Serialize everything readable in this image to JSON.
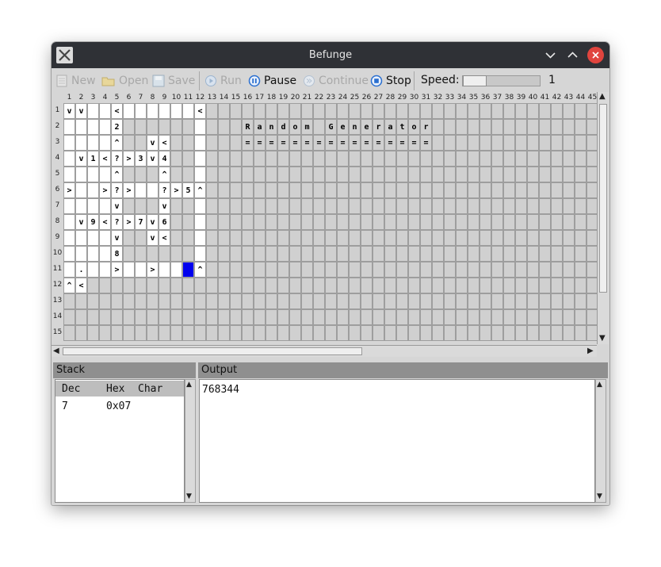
{
  "window": {
    "title": "Befunge"
  },
  "toolbar": {
    "new": "New",
    "open": "Open",
    "save": "Save",
    "run": "Run",
    "pause": "Pause",
    "continue": "Continue",
    "stop": "Stop",
    "speed_label": "Speed:",
    "speed_value": "1"
  },
  "grid": {
    "columns": [
      "1",
      "2",
      "3",
      "4",
      "5",
      "6",
      "7",
      "8",
      "9",
      "10",
      "11",
      "12",
      "13",
      "14",
      "15",
      "16",
      "17",
      "18",
      "19",
      "20",
      "21",
      "22",
      "23",
      "24",
      "25",
      "26",
      "27",
      "28",
      "29",
      "30",
      "31",
      "32",
      "33",
      "34",
      "35",
      "36",
      "37",
      "38",
      "39",
      "40",
      "41",
      "42",
      "43",
      "44",
      "45"
    ],
    "rows": [
      "1",
      "2",
      "3",
      "4",
      "5",
      "6",
      "7",
      "8",
      "9",
      "10",
      "11",
      "12",
      "13",
      "14",
      "15"
    ],
    "white_cells": [
      [
        1,
        1
      ],
      [
        2,
        1
      ],
      [
        3,
        1
      ],
      [
        4,
        1
      ],
      [
        5,
        1
      ],
      [
        6,
        1
      ],
      [
        7,
        1
      ],
      [
        8,
        1
      ],
      [
        9,
        1
      ],
      [
        10,
        1
      ],
      [
        11,
        1
      ],
      [
        12,
        1
      ],
      [
        1,
        2
      ],
      [
        2,
        2
      ],
      [
        3,
        2
      ],
      [
        4,
        2
      ],
      [
        5,
        2
      ],
      [
        12,
        2
      ],
      [
        1,
        3
      ],
      [
        2,
        3
      ],
      [
        3,
        3
      ],
      [
        4,
        3
      ],
      [
        5,
        3
      ],
      [
        8,
        3
      ],
      [
        9,
        3
      ],
      [
        12,
        3
      ],
      [
        1,
        4
      ],
      [
        2,
        4
      ],
      [
        3,
        4
      ],
      [
        4,
        4
      ],
      [
        5,
        4
      ],
      [
        6,
        4
      ],
      [
        7,
        4
      ],
      [
        8,
        4
      ],
      [
        9,
        4
      ],
      [
        12,
        4
      ],
      [
        1,
        5
      ],
      [
        2,
        5
      ],
      [
        3,
        5
      ],
      [
        4,
        5
      ],
      [
        5,
        5
      ],
      [
        9,
        5
      ],
      [
        12,
        5
      ],
      [
        1,
        6
      ],
      [
        2,
        6
      ],
      [
        3,
        6
      ],
      [
        4,
        6
      ],
      [
        5,
        6
      ],
      [
        6,
        6
      ],
      [
        7,
        6
      ],
      [
        8,
        6
      ],
      [
        9,
        6
      ],
      [
        10,
        6
      ],
      [
        11,
        6
      ],
      [
        12,
        6
      ],
      [
        1,
        7
      ],
      [
        2,
        7
      ],
      [
        3,
        7
      ],
      [
        4,
        7
      ],
      [
        5,
        7
      ],
      [
        9,
        7
      ],
      [
        12,
        7
      ],
      [
        1,
        8
      ],
      [
        2,
        8
      ],
      [
        3,
        8
      ],
      [
        4,
        8
      ],
      [
        5,
        8
      ],
      [
        6,
        8
      ],
      [
        7,
        8
      ],
      [
        8,
        8
      ],
      [
        9,
        8
      ],
      [
        12,
        8
      ],
      [
        1,
        9
      ],
      [
        2,
        9
      ],
      [
        3,
        9
      ],
      [
        4,
        9
      ],
      [
        5,
        9
      ],
      [
        8,
        9
      ],
      [
        9,
        9
      ],
      [
        12,
        9
      ],
      [
        1,
        10
      ],
      [
        2,
        10
      ],
      [
        3,
        10
      ],
      [
        4,
        10
      ],
      [
        5,
        10
      ],
      [
        12,
        10
      ],
      [
        1,
        11
      ],
      [
        2,
        11
      ],
      [
        3,
        11
      ],
      [
        4,
        11
      ],
      [
        5,
        11
      ],
      [
        6,
        11
      ],
      [
        7,
        11
      ],
      [
        8,
        11
      ],
      [
        9,
        11
      ],
      [
        10,
        11
      ],
      [
        12,
        11
      ],
      [
        1,
        12
      ],
      [
        2,
        12
      ]
    ],
    "cursor": [
      11,
      11
    ],
    "cells": [
      [
        1,
        1,
        "v"
      ],
      [
        2,
        1,
        "v"
      ],
      [
        5,
        1,
        "<"
      ],
      [
        12,
        1,
        "<"
      ],
      [
        5,
        2,
        "2"
      ],
      [
        16,
        2,
        "R"
      ],
      [
        17,
        2,
        "a"
      ],
      [
        18,
        2,
        "n"
      ],
      [
        19,
        2,
        "d"
      ],
      [
        20,
        2,
        "o"
      ],
      [
        21,
        2,
        "m"
      ],
      [
        23,
        2,
        "G"
      ],
      [
        24,
        2,
        "e"
      ],
      [
        25,
        2,
        "n"
      ],
      [
        26,
        2,
        "e"
      ],
      [
        27,
        2,
        "r"
      ],
      [
        28,
        2,
        "a"
      ],
      [
        29,
        2,
        "t"
      ],
      [
        30,
        2,
        "o"
      ],
      [
        31,
        2,
        "r"
      ],
      [
        5,
        3,
        "^"
      ],
      [
        8,
        3,
        "v"
      ],
      [
        9,
        3,
        "<"
      ],
      [
        16,
        3,
        "="
      ],
      [
        17,
        3,
        "="
      ],
      [
        18,
        3,
        "="
      ],
      [
        19,
        3,
        "="
      ],
      [
        20,
        3,
        "="
      ],
      [
        21,
        3,
        "="
      ],
      [
        22,
        3,
        "="
      ],
      [
        23,
        3,
        "="
      ],
      [
        24,
        3,
        "="
      ],
      [
        25,
        3,
        "="
      ],
      [
        26,
        3,
        "="
      ],
      [
        27,
        3,
        "="
      ],
      [
        28,
        3,
        "="
      ],
      [
        29,
        3,
        "="
      ],
      [
        30,
        3,
        "="
      ],
      [
        31,
        3,
        "="
      ],
      [
        2,
        4,
        "v"
      ],
      [
        3,
        4,
        "1"
      ],
      [
        4,
        4,
        "<"
      ],
      [
        5,
        4,
        "?"
      ],
      [
        6,
        4,
        ">"
      ],
      [
        7,
        4,
        "3"
      ],
      [
        8,
        4,
        "v"
      ],
      [
        9,
        4,
        "4"
      ],
      [
        5,
        5,
        "^"
      ],
      [
        9,
        5,
        "^"
      ],
      [
        1,
        6,
        ">"
      ],
      [
        4,
        6,
        ">"
      ],
      [
        5,
        6,
        "?"
      ],
      [
        6,
        6,
        ">"
      ],
      [
        9,
        6,
        "?"
      ],
      [
        10,
        6,
        ">"
      ],
      [
        11,
        6,
        "5"
      ],
      [
        12,
        6,
        "^"
      ],
      [
        5,
        7,
        "v"
      ],
      [
        9,
        7,
        "v"
      ],
      [
        2,
        8,
        "v"
      ],
      [
        3,
        8,
        "9"
      ],
      [
        4,
        8,
        "<"
      ],
      [
        5,
        8,
        "?"
      ],
      [
        6,
        8,
        ">"
      ],
      [
        7,
        8,
        "7"
      ],
      [
        8,
        8,
        "v"
      ],
      [
        9,
        8,
        "6"
      ],
      [
        5,
        9,
        "v"
      ],
      [
        8,
        9,
        "v"
      ],
      [
        9,
        9,
        "<"
      ],
      [
        5,
        10,
        "8"
      ],
      [
        2,
        11,
        "."
      ],
      [
        5,
        11,
        ">"
      ],
      [
        8,
        11,
        ">"
      ],
      [
        12,
        11,
        "^"
      ],
      [
        1,
        12,
        "^"
      ],
      [
        2,
        12,
        "<"
      ]
    ]
  },
  "stack": {
    "title": "Stack",
    "headers": {
      "dec": "Dec",
      "hex": "Hex",
      "char": "Char"
    },
    "rows": [
      {
        "dec": "7",
        "hex": "0x07",
        "char": ""
      }
    ]
  },
  "output": {
    "title": "Output",
    "text": "768344"
  },
  "colors": {
    "titlebar": "#2f3136",
    "close": "#e0443e",
    "cursor": "#0000ee",
    "accent": "#2a6fd0"
  }
}
